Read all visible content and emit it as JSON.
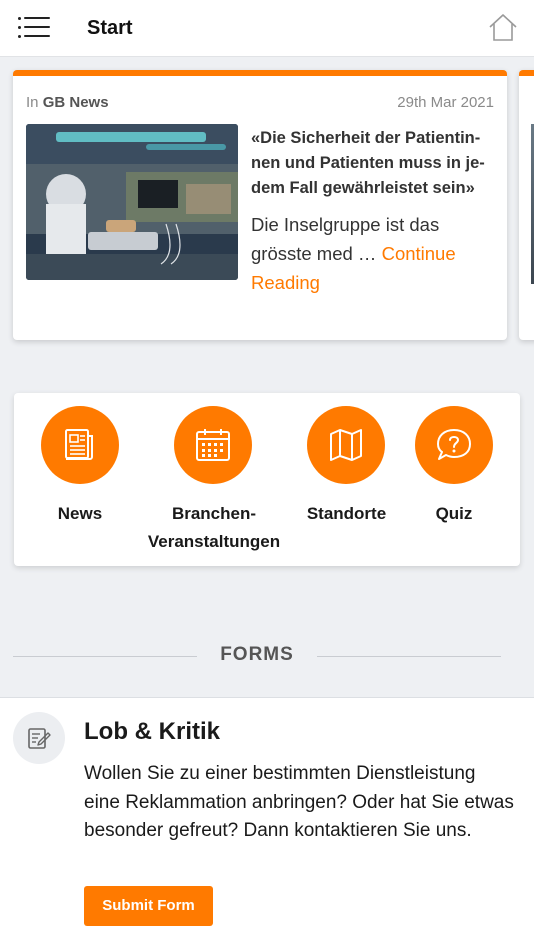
{
  "header": {
    "title": "Start",
    "menu_icon": "menu-list-icon",
    "home_icon": "home-icon"
  },
  "news_card": {
    "source_prefix": "In",
    "source": "GB News",
    "date": "29th Mar 2021",
    "headline": "«Die Sicherheit der Patientin­nen und Patienten muss in je­dem Fall gewährleistet sein»",
    "excerpt": "Die Inselgruppe ist das grösste med … ",
    "continue_label": "Continue Reading",
    "image": "operating-room-photo"
  },
  "quick_links": [
    {
      "label": "News",
      "icon": "newspaper-icon"
    },
    {
      "label": "Branchen-Veranstaltungen",
      "icon": "calendar-icon"
    },
    {
      "label": "Standorte",
      "icon": "map-icon"
    },
    {
      "label": "Quiz",
      "icon": "question-bubble-icon"
    }
  ],
  "forms_section": {
    "title": "FORMS"
  },
  "form": {
    "icon": "edit-form-icon",
    "title": "Lob & Kritik",
    "description": "Wollen Sie zu einer bestimmten Dienstleistung eine Reklammation anbringen? Oder hat Sie etwas besonder gefreut? Dann kontaktieren Sie uns.",
    "button_label": "Submit Form"
  },
  "colors": {
    "accent": "#ff7a00",
    "background": "#eef0f3",
    "card": "#ffffff"
  }
}
